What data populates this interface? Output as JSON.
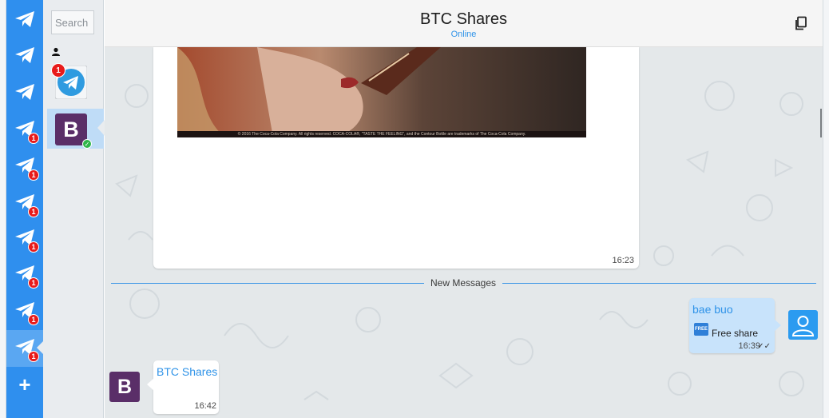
{
  "rail": {
    "accounts": [
      {
        "id": "account-1",
        "badge": ""
      },
      {
        "id": "account-2",
        "badge": ""
      },
      {
        "id": "account-3",
        "badge": ""
      },
      {
        "id": "account-4",
        "badge": "1"
      },
      {
        "id": "account-5",
        "badge": "1"
      },
      {
        "id": "account-6",
        "badge": "1"
      },
      {
        "id": "account-7",
        "badge": "1"
      },
      {
        "id": "account-8",
        "badge": "1"
      },
      {
        "id": "account-9",
        "badge": "1"
      },
      {
        "id": "account-10",
        "badge": "1",
        "active": true
      }
    ],
    "add_label": "+"
  },
  "chatlist": {
    "search_placeholder": "Search",
    "telegram_badge": "1",
    "btc_avatar_letter": "B"
  },
  "header": {
    "title": "BTC Shares",
    "status": "Online"
  },
  "messages": {
    "image_time": "16:23",
    "image_caption": "© 2016 The Coca-Cola Company. All rights reserved. COCA-COLA®, \"TASTE THE FEELING\", and the Contour Bottle are trademarks of The Coca-Cola Company.",
    "divider_label": "New Messages",
    "outgoing": {
      "sender": "bae buo",
      "icon_label": "FREE",
      "text": "Free share",
      "time": "16:39"
    },
    "incoming": {
      "sender": "BTC Shares",
      "avatar_letter": "B",
      "time": "16:42"
    }
  },
  "colors": {
    "rail_blue": "#2f8fee",
    "accent_blue": "#2f93e8",
    "badge_red": "#e81b1b",
    "outgoing_bubble": "#c8e3fb",
    "btc_purple": "#5a2e68"
  }
}
